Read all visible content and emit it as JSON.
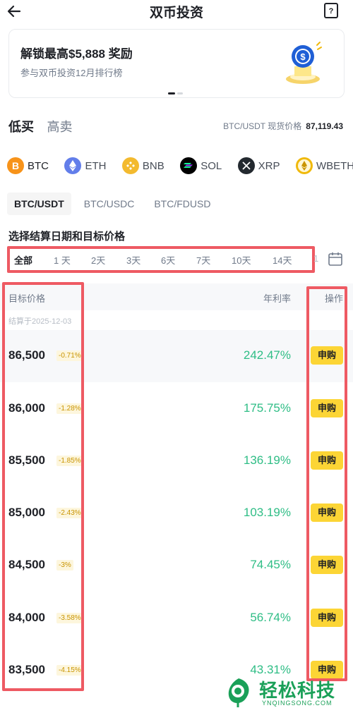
{
  "header": {
    "title": "双币投资"
  },
  "banner": {
    "title": "解锁最高$5,888 奖励",
    "subtitle": "参与双币投资12月排行榜"
  },
  "mode_tabs": [
    {
      "label": "低买",
      "active": true
    },
    {
      "label": "高卖",
      "active": false
    }
  ],
  "spot": {
    "label": "BTC/USDT 现货价格",
    "value": "87,119.43"
  },
  "coins": [
    {
      "symbol": "BTC",
      "icon": "btc-icon",
      "color": "#f7931a",
      "active": true
    },
    {
      "symbol": "ETH",
      "icon": "eth-icon",
      "color": "#627eea",
      "active": false
    },
    {
      "symbol": "BNB",
      "icon": "bnb-icon",
      "color": "#f3ba2f",
      "active": false
    },
    {
      "symbol": "SOL",
      "icon": "sol-icon",
      "color": "#000000",
      "active": false
    },
    {
      "symbol": "XRP",
      "icon": "xrp-icon",
      "color": "#23292f",
      "active": false
    },
    {
      "symbol": "WBETH",
      "icon": "wbeth-icon",
      "color": "#f0b90b",
      "active": false
    }
  ],
  "pairs": [
    {
      "label": "BTC/USDT",
      "active": true
    },
    {
      "label": "BTC/USDC",
      "active": false
    },
    {
      "label": "BTC/FDUSD",
      "active": false
    }
  ],
  "section_title": "选择结算日期和目标价格",
  "date_filters": [
    {
      "label": "全部",
      "active": true
    },
    {
      "label": "1 天",
      "active": false
    },
    {
      "label": "2天",
      "active": false
    },
    {
      "label": "3天",
      "active": false
    },
    {
      "label": "6天",
      "active": false
    },
    {
      "label": "7天",
      "active": false
    },
    {
      "label": "10天",
      "active": false
    },
    {
      "label": "14天",
      "active": false
    }
  ],
  "date_more": "1",
  "table": {
    "headers": {
      "price": "目标价格",
      "apr": "年利率",
      "action": "操作"
    },
    "settle_date": "结算于2025-12-03",
    "rows": [
      {
        "price": "86,500",
        "pct": "-0.71%",
        "apr": "242.47%",
        "action": "申购"
      },
      {
        "price": "86,000",
        "pct": "-1.28%",
        "apr": "175.75%",
        "action": "申购"
      },
      {
        "price": "85,500",
        "pct": "-1.85%",
        "apr": "136.19%",
        "action": "申购"
      },
      {
        "price": "85,000",
        "pct": "-2.43%",
        "apr": "103.19%",
        "action": "申购"
      },
      {
        "price": "84,500",
        "pct": "-3%",
        "apr": "74.45%",
        "action": "申购"
      },
      {
        "price": "84,000",
        "pct": "-3.58%",
        "apr": "56.74%",
        "action": "申购"
      },
      {
        "price": "83,500",
        "pct": "-4.15%",
        "apr": "43.31%",
        "action": "申购"
      }
    ]
  },
  "watermark": {
    "text": "轻松科技",
    "sub": "YNQINGSONG.COM"
  },
  "colors": {
    "accent": "#fcd535",
    "positive": "#2ebd85",
    "annotation": "#ee5a63"
  }
}
